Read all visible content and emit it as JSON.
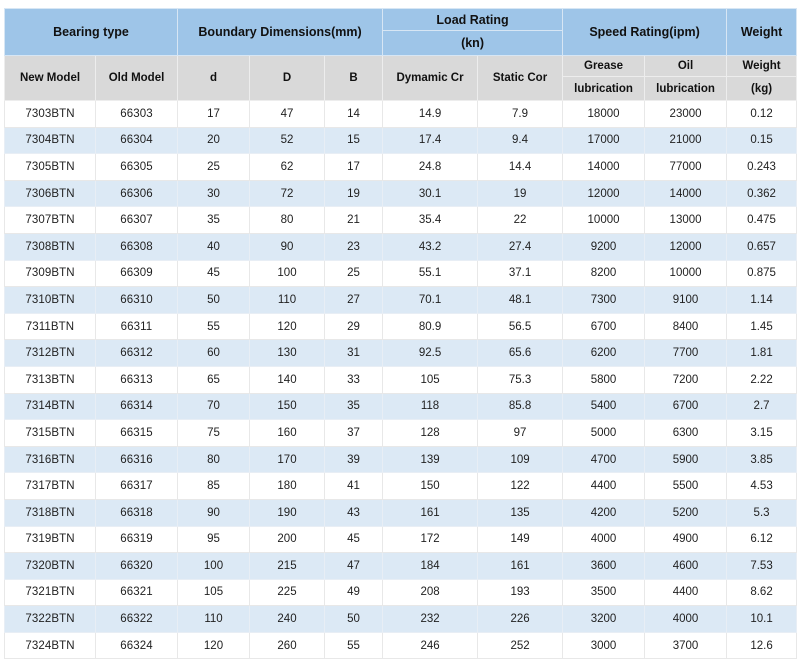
{
  "table": {
    "header_groups": [
      {
        "label": "Bearing type",
        "span": 2
      },
      {
        "label": "Boundary Dimensions(mm)",
        "span": 3
      },
      {
        "label": "Load Rating",
        "label2": "(kn)",
        "span": 2
      },
      {
        "label": "Speed Rating(ipm)",
        "span": 2
      },
      {
        "label": "Weight",
        "span": 1
      }
    ],
    "columns": [
      {
        "key": "new_model",
        "label": "New Model",
        "label2": ""
      },
      {
        "key": "old_model",
        "label": "Old Model",
        "label2": ""
      },
      {
        "key": "d",
        "label": "d",
        "label2": ""
      },
      {
        "key": "D",
        "label": "D",
        "label2": ""
      },
      {
        "key": "B",
        "label": "B",
        "label2": ""
      },
      {
        "key": "dynamic_cr",
        "label": "Dymamic Cr",
        "label2": ""
      },
      {
        "key": "static_cor",
        "label": "Static Cor",
        "label2": ""
      },
      {
        "key": "grease_lubrication",
        "label": "Grease",
        "label2": "lubrication"
      },
      {
        "key": "oil_lubrication",
        "label": "Oil",
        "label2": "lubrication"
      },
      {
        "key": "weight",
        "label": "Weight",
        "label2": "(kg)"
      }
    ],
    "rows": [
      [
        "7303BTN",
        "66303",
        "17",
        "47",
        "14",
        "14.9",
        "7.9",
        "18000",
        "23000",
        "0.12"
      ],
      [
        "7304BTN",
        "66304",
        "20",
        "52",
        "15",
        "17.4",
        "9.4",
        "17000",
        "21000",
        "0.15"
      ],
      [
        "7305BTN",
        "66305",
        "25",
        "62",
        "17",
        "24.8",
        "14.4",
        "14000",
        "77000",
        "0.243"
      ],
      [
        "7306BTN",
        "66306",
        "30",
        "72",
        "19",
        "30.1",
        "19",
        "12000",
        "14000",
        "0.362"
      ],
      [
        "7307BTN",
        "66307",
        "35",
        "80",
        "21",
        "35.4",
        "22",
        "10000",
        "13000",
        "0.475"
      ],
      [
        "7308BTN",
        "66308",
        "40",
        "90",
        "23",
        "43.2",
        "27.4",
        "9200",
        "12000",
        "0.657"
      ],
      [
        "7309BTN",
        "66309",
        "45",
        "100",
        "25",
        "55.1",
        "37.1",
        "8200",
        "10000",
        "0.875"
      ],
      [
        "7310BTN",
        "66310",
        "50",
        "110",
        "27",
        "70.1",
        "48.1",
        "7300",
        "9100",
        "1.14"
      ],
      [
        "7311BTN",
        "66311",
        "55",
        "120",
        "29",
        "80.9",
        "56.5",
        "6700",
        "8400",
        "1.45"
      ],
      [
        "7312BTN",
        "66312",
        "60",
        "130",
        "31",
        "92.5",
        "65.6",
        "6200",
        "7700",
        "1.81"
      ],
      [
        "7313BTN",
        "66313",
        "65",
        "140",
        "33",
        "105",
        "75.3",
        "5800",
        "7200",
        "2.22"
      ],
      [
        "7314BTN",
        "66314",
        "70",
        "150",
        "35",
        "118",
        "85.8",
        "5400",
        "6700",
        "2.7"
      ],
      [
        "7315BTN",
        "66315",
        "75",
        "160",
        "37",
        "128",
        "97",
        "5000",
        "6300",
        "3.15"
      ],
      [
        "7316BTN",
        "66316",
        "80",
        "170",
        "39",
        "139",
        "109",
        "4700",
        "5900",
        "3.85"
      ],
      [
        "7317BTN",
        "66317",
        "85",
        "180",
        "41",
        "150",
        "122",
        "4400",
        "5500",
        "4.53"
      ],
      [
        "7318BTN",
        "66318",
        "90",
        "190",
        "43",
        "161",
        "135",
        "4200",
        "5200",
        "5.3"
      ],
      [
        "7319BTN",
        "66319",
        "95",
        "200",
        "45",
        "172",
        "149",
        "4000",
        "4900",
        "6.12"
      ],
      [
        "7320BTN",
        "66320",
        "100",
        "215",
        "47",
        "184",
        "161",
        "3600",
        "4600",
        "7.53"
      ],
      [
        "7321BTN",
        "66321",
        "105",
        "225",
        "49",
        "208",
        "193",
        "3500",
        "4400",
        "8.62"
      ],
      [
        "7322BTN",
        "66322",
        "110",
        "240",
        "50",
        "232",
        "226",
        "3200",
        "4000",
        "10.1"
      ],
      [
        "7324BTN",
        "66324",
        "120",
        "260",
        "55",
        "246",
        "252",
        "3000",
        "3700",
        "12.6"
      ]
    ]
  },
  "colors": {
    "header_blue": "#9ec5e8",
    "subheader_gray": "#d9d9d9",
    "row_alt_blue": "#dce9f5",
    "row_white": "#ffffff",
    "text": "#1a1a1a"
  }
}
